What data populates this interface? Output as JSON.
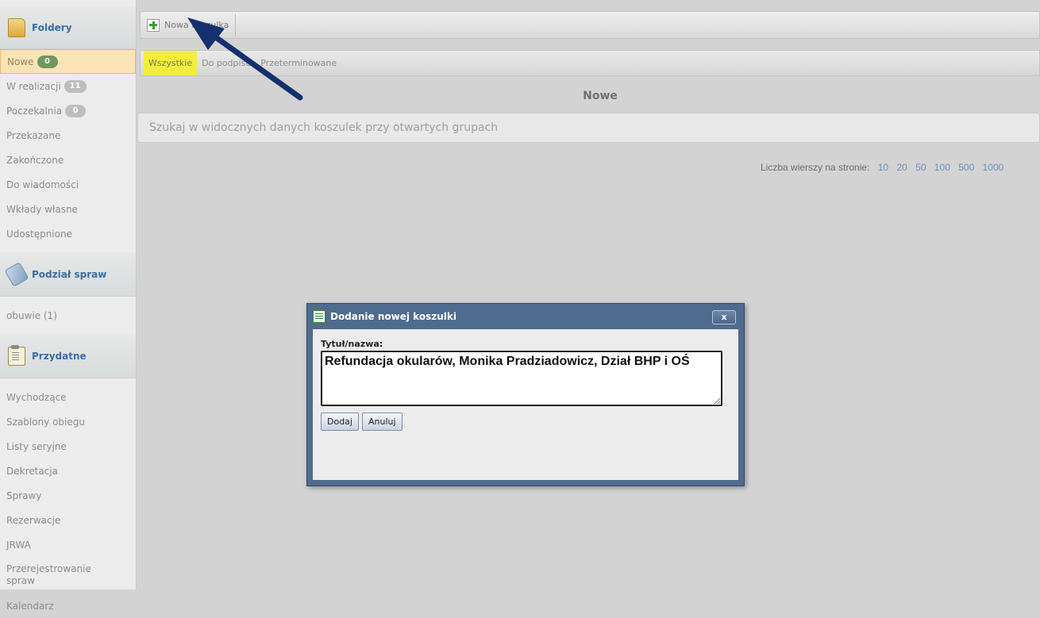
{
  "sidebar": {
    "folders_header": "Foldery",
    "folders": [
      {
        "label": "Nowe",
        "badge": "0"
      },
      {
        "label": "W realizacji",
        "badge": "11"
      },
      {
        "label": "Poczekalnia",
        "badge": "0"
      },
      {
        "label": "Przekazane"
      },
      {
        "label": "Zakończone"
      },
      {
        "label": "Do wiadomości"
      },
      {
        "label": "Wkłady własne"
      },
      {
        "label": "Udostępnione"
      }
    ],
    "division_header": "Podział spraw",
    "division_items": [
      {
        "label": "obuwie (1)"
      }
    ],
    "useful_header": "Przydatne",
    "useful_items": [
      {
        "label": "Wychodzące"
      },
      {
        "label": "Szablony obiegu"
      },
      {
        "label": "Listy seryjne"
      },
      {
        "label": "Dekretacja"
      },
      {
        "label": "Sprawy"
      },
      {
        "label": "Rezerwacje"
      },
      {
        "label": "JRWA"
      },
      {
        "label": "Przerejestrowanie spraw"
      },
      {
        "label": "Kalendarz"
      }
    ]
  },
  "toolbar": {
    "new_folder_label": "Nowa koszulka"
  },
  "filters": {
    "all": "Wszystkie",
    "to_sign": "Do podpisu",
    "overdue": "Przeterminowane"
  },
  "main": {
    "section_title": "Nowe",
    "search_placeholder": "Szukaj w widocznych danych koszulek przy otwartych grupach",
    "rows_label": "Liczba wierszy na stronie:",
    "rows_options": [
      "10",
      "20",
      "50",
      "100",
      "500",
      "1000"
    ]
  },
  "dialog": {
    "title": "Dodanie nowej koszulki",
    "close_label": "x",
    "field_label": "Tytuł/nazwa:",
    "field_value": "Refundacja okularów, Monika Pradziadowicz, Dział BHP i OŚ",
    "add_button": "Dodaj",
    "cancel_button": "Anuluj"
  },
  "colors": {
    "accent_blue": "#3a6ea5",
    "active_folder_bg": "#fbe3b8",
    "filter_selected_bg": "#f1ee3b",
    "dialog_frame": "#4f6b8e",
    "arrow": "#14306e"
  }
}
